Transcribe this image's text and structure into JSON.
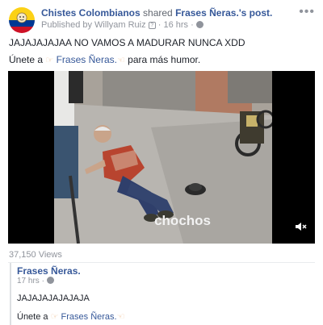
{
  "header": {
    "page_name": "Chistes Colombianos",
    "shared_text": "shared",
    "source_name": "Frases Ñeras.",
    "post_suffix": "'s post.",
    "published_by": "Published by Willyam Ruiz",
    "info_mark": "?",
    "time": "16 hrs",
    "more_label": "•••"
  },
  "post": {
    "line1": "JAJAJAJAJAA NO VAMOS A MADURAR NUNCA XDD",
    "line2_prefix": "Únete a",
    "line2_link": "Frases Ñeras.",
    "line2_suffix": "para más humor.",
    "hand_icon": "pointing-hand-icon"
  },
  "video": {
    "watermark": "chochos",
    "mute_icon": "◀✕"
  },
  "views": "37,150 Views",
  "shared": {
    "name": "Frases Ñeras.",
    "time": "17 hrs",
    "text1": "JAJAJAJAJAJAJA",
    "text2_prefix": "Únete a",
    "text2_link": "Frases Ñeras."
  },
  "colors": {
    "link": "#365899",
    "muted": "#90949c",
    "text": "#1d2129",
    "colombia_yellow": "#fcd116",
    "colombia_blue": "#003893",
    "colombia_red": "#ce1126"
  }
}
